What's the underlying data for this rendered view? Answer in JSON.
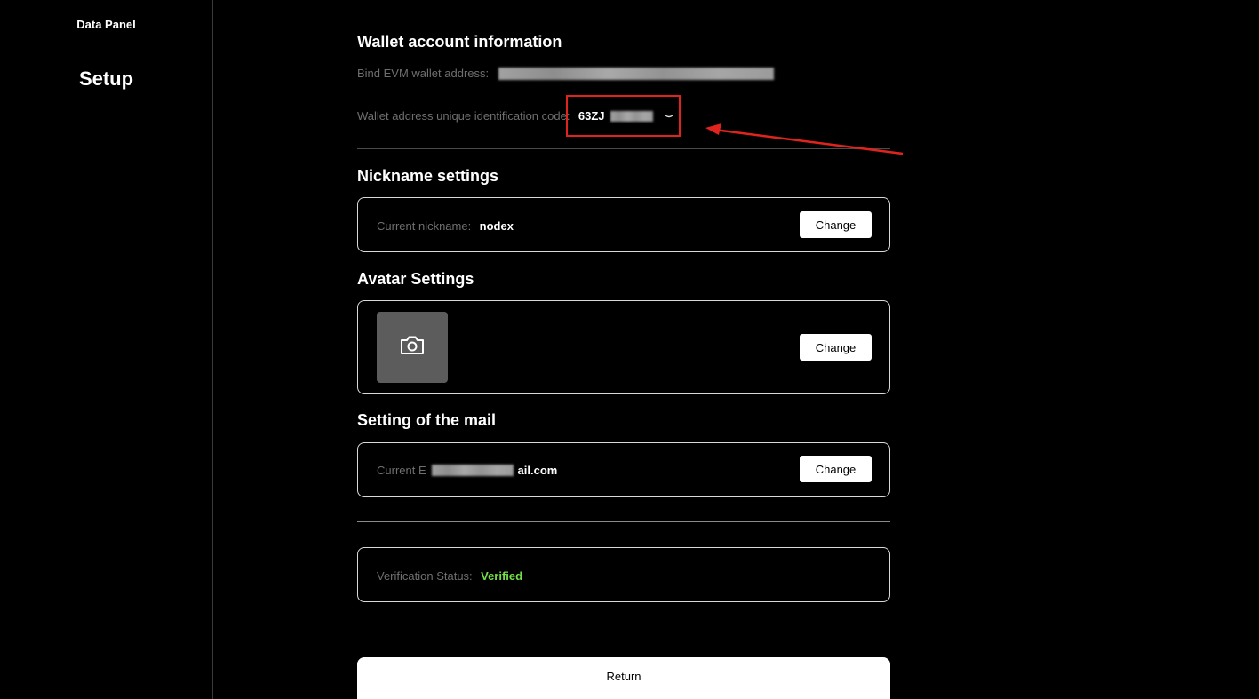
{
  "sidebar": {
    "items": [
      {
        "label": "Data Panel"
      },
      {
        "label": "Setup"
      }
    ]
  },
  "wallet": {
    "title": "Wallet account information",
    "bind_label": "Bind EVM wallet address:",
    "uid_label": "Wallet address unique identification code:",
    "uid_value": "63ZJ"
  },
  "nickname": {
    "title": "Nickname settings",
    "label": "Current nickname:",
    "value": "nodex",
    "button": "Change"
  },
  "avatar": {
    "title": "Avatar Settings",
    "icon": "camera-icon",
    "button": "Change"
  },
  "mail": {
    "title": "Setting of the mail",
    "label": "Current E",
    "value_suffix": "ail.com",
    "button": "Change"
  },
  "verification": {
    "label": "Verification Status:",
    "value": "Verified"
  },
  "return_label": "Return",
  "colors": {
    "background": "#000000",
    "verified": "#73e047",
    "annotation": "#e0241d",
    "card_border": "#d9d9d9",
    "avatar_bg": "#5c5c5c"
  }
}
